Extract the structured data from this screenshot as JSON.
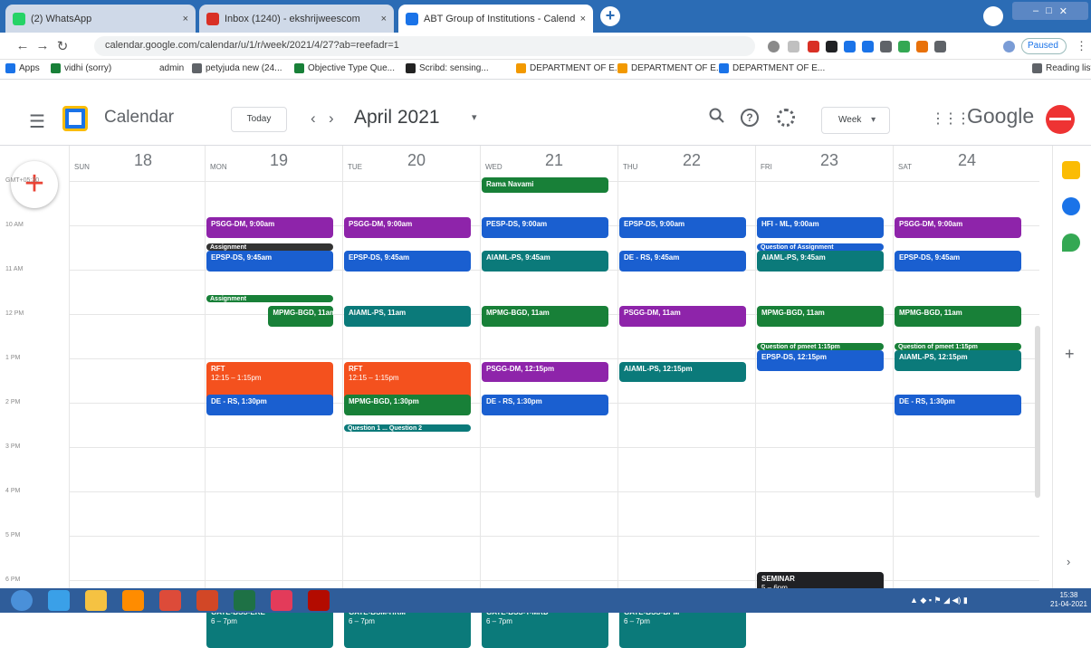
{
  "browser": {
    "tabs": [
      {
        "label": "(2) WhatsApp",
        "close": "×",
        "color": "#25d366"
      },
      {
        "label": "Inbox (1240) - ekshrijweescom",
        "close": "×",
        "color": "#d93025"
      },
      {
        "label": "ABT Group of Institutions - Calendar",
        "close": "×",
        "color": "#1a73e8"
      }
    ],
    "new_tab": "+",
    "window_controls": [
      "–",
      "□",
      "✕"
    ],
    "url": "calendar.google.com/calendar/u/1/r/week/2021/4/27?ab=reefadr=1",
    "profile_status": "Paused",
    "bookmarks": [
      {
        "label": "Apps",
        "color": "#1a73e8"
      },
      {
        "label": "vidhi (sorry)",
        "color": "#188038"
      },
      {
        "label": "admin",
        "color": "#888888"
      },
      {
        "label": "petyjuda new (24...",
        "color": "#5f6368"
      },
      {
        "label": "Objective Type Que...",
        "color": "#188038"
      },
      {
        "label": "Scribd: sensing...",
        "color": "#222222"
      },
      {
        "label": "DEPARTMENT OF E...",
        "color": "#f29900"
      },
      {
        "label": "DEPARTMENT OF E...",
        "color": "#f29900"
      },
      {
        "label": "DEPARTMENT OF E...",
        "color": "#1a73e8"
      },
      {
        "label": "Reading list",
        "color": "#5f6368"
      }
    ]
  },
  "header": {
    "app_title": "Calendar",
    "today_label": "Today",
    "prev": "‹",
    "next": "›",
    "period": "April 2021",
    "period_caret": "▾",
    "view": "Week",
    "view_caret": "▾",
    "brand": "Google",
    "help": "?"
  },
  "create_label": "+",
  "days": [
    {
      "name": "SUN",
      "num": "18"
    },
    {
      "name": "MON",
      "num": "19"
    },
    {
      "name": "TUE",
      "num": "20"
    },
    {
      "name": "WED",
      "num": "21"
    },
    {
      "name": "THU",
      "num": "22"
    },
    {
      "name": "FRI",
      "num": "23"
    },
    {
      "name": "SAT",
      "num": "24"
    }
  ],
  "time_labels": [
    "GMT+05:30",
    "10 AM",
    "11 AM",
    "12 PM",
    "1 PM",
    "2 PM",
    "3 PM",
    "4 PM",
    "5 PM",
    "6 PM"
  ],
  "all_day_events": [
    {
      "day": 3,
      "title": "Rama Navami",
      "color": "#188038"
    }
  ],
  "events": [
    {
      "day": 1,
      "start": "9:00",
      "end": "9:30",
      "title": "PSGG-DM, 9:00am",
      "time": "",
      "color": "#8e24aa"
    },
    {
      "day": 2,
      "start": "9:00",
      "end": "9:30",
      "title": "PSGG-DM, 9:00am",
      "time": "",
      "color": "#8e24aa"
    },
    {
      "day": 3,
      "start": "9:00",
      "end": "9:30",
      "title": "PESP-DS, 9:00am",
      "time": "",
      "color": "#1a5fd0"
    },
    {
      "day": 4,
      "start": "9:00",
      "end": "9:30",
      "title": "EPSP-DS, 9:00am",
      "time": "",
      "color": "#1a5fd0"
    },
    {
      "day": 5,
      "start": "9:00",
      "end": "9:30",
      "title": "HFI - ML, 9:00am",
      "time": "",
      "color": "#1a5fd0"
    },
    {
      "day": 6,
      "start": "9:00",
      "end": "9:30",
      "title": "PSGG-DM, 9:00am",
      "time": "",
      "color": "#8e24aa"
    },
    {
      "day": 1,
      "start": "9:35",
      "end": "9:45",
      "title": "Assignment",
      "time": "",
      "color": "#333333",
      "small": true
    },
    {
      "day": 1,
      "start": "9:45",
      "end": "10:15",
      "title": "EPSP-DS, 9:45am",
      "time": "",
      "color": "#1a5fd0"
    },
    {
      "day": 2,
      "start": "9:45",
      "end": "10:15",
      "title": "EPSP-DS, 9:45am",
      "time": "",
      "color": "#1a5fd0"
    },
    {
      "day": 3,
      "start": "9:45",
      "end": "10:15",
      "title": "AIAML-PS, 9:45am",
      "time": "",
      "color": "#0b7a7a"
    },
    {
      "day": 4,
      "start": "9:45",
      "end": "10:15",
      "title": "DE - RS, 9:45am",
      "time": "",
      "color": "#1a5fd0"
    },
    {
      "day": 5,
      "start": "9:35",
      "end": "9:43",
      "title": "Question of Assignment",
      "time": "",
      "color": "#1a5fd0",
      "small": true
    },
    {
      "day": 5,
      "start": "9:45",
      "end": "10:15",
      "title": "AIAML-PS, 9:45am",
      "time": "",
      "color": "#0b7a7a"
    },
    {
      "day": 6,
      "start": "9:45",
      "end": "10:15",
      "title": "EPSP-DS, 9:45am",
      "time": "",
      "color": "#1a5fd0"
    },
    {
      "day": 1,
      "start": "10:45",
      "end": "10:55",
      "title": "Assignment",
      "time": "",
      "color": "#188038",
      "small": true
    },
    {
      "day": 1,
      "start": "11:00",
      "end": "11:30",
      "title": "MPMG-BGD, 11am",
      "time": "",
      "color": "#188038",
      "shift": 0.45
    },
    {
      "day": 2,
      "start": "11:00",
      "end": "11:30",
      "title": "AIAML-PS, 11am",
      "time": "",
      "color": "#0b7a7a"
    },
    {
      "day": 3,
      "start": "11:00",
      "end": "11:30",
      "title": "MPMG-BGD, 11am",
      "time": "",
      "color": "#188038"
    },
    {
      "day": 4,
      "start": "11:00",
      "end": "11:30",
      "title": "PSGG-DM, 11am",
      "time": "",
      "color": "#8e24aa"
    },
    {
      "day": 5,
      "start": "11:00",
      "end": "11:30",
      "title": "MPMG-BGD, 11am",
      "time": "",
      "color": "#188038"
    },
    {
      "day": 6,
      "start": "11:00",
      "end": "11:30",
      "title": "MPMG-BGD, 11am",
      "time": "",
      "color": "#188038"
    },
    {
      "day": 5,
      "start": "11:50",
      "end": "11:58",
      "title": "Question of pmeet 1:15pm",
      "time": "",
      "color": "#188038",
      "small": true
    },
    {
      "day": 6,
      "start": "11:50",
      "end": "11:58",
      "title": "Question of pmeet 1:15pm",
      "time": "",
      "color": "#188038",
      "small": true
    },
    {
      "day": 1,
      "start": "12:15",
      "end": "13:15",
      "title": "RFT",
      "time": "12:15 – 1:15pm",
      "color": "#f4511e"
    },
    {
      "day": 2,
      "start": "12:15",
      "end": "13:15",
      "title": "RFT",
      "time": "12:15 – 1:15pm",
      "color": "#f4511e"
    },
    {
      "day": 3,
      "start": "12:15",
      "end": "12:45",
      "title": "PSGG-DM, 12:15pm",
      "time": "",
      "color": "#8e24aa"
    },
    {
      "day": 4,
      "start": "12:15",
      "end": "12:45",
      "title": "AIAML-PS, 12:15pm",
      "time": "",
      "color": "#0b7a7a"
    },
    {
      "day": 5,
      "start": "12:00",
      "end": "12:30",
      "title": "EPSP-DS, 12:15pm",
      "time": "",
      "color": "#1a5fd0"
    },
    {
      "day": 6,
      "start": "12:00",
      "end": "12:30",
      "title": "AIAML-PS, 12:15pm",
      "time": "",
      "color": "#0b7a7a"
    },
    {
      "day": 1,
      "start": "13:00",
      "end": "13:30",
      "title": "DE - RS, 1:30pm",
      "time": "",
      "color": "#1a5fd0"
    },
    {
      "day": 2,
      "start": "13:00",
      "end": "13:30",
      "title": "MPMG-BGD, 1:30pm",
      "time": "",
      "color": "#188038"
    },
    {
      "day": 3,
      "start": "13:00",
      "end": "13:30",
      "title": "DE - RS, 1:30pm",
      "time": "",
      "color": "#1a5fd0"
    },
    {
      "day": 6,
      "start": "13:00",
      "end": "13:30",
      "title": "DE - RS, 1:30pm",
      "time": "",
      "color": "#1a5fd0"
    },
    {
      "day": 2,
      "start": "13:40",
      "end": "13:48",
      "title": "Question 1 ... Question 2",
      "time": "",
      "color": "#0b7a7a",
      "small": true
    },
    {
      "day": 5,
      "start": "17:00",
      "end": "17:45",
      "title": "SEMINAR",
      "time": "5 – 6pm",
      "color": "#202124"
    },
    {
      "day": 1,
      "start": "17:45",
      "end": "18:45",
      "title": "GATE-BSS-ERE",
      "time": "6 – 7pm",
      "color": "#0b7a7a"
    },
    {
      "day": 2,
      "start": "17:45",
      "end": "18:45",
      "title": "GATE-BSM-HRM",
      "time": "6 – 7pm",
      "color": "#0b7a7a"
    },
    {
      "day": 3,
      "start": "17:45",
      "end": "18:45",
      "title": "GATE-BSS-T-MRD",
      "time": "6 – 7pm",
      "color": "#0b7a7a"
    },
    {
      "day": 4,
      "start": "17:45",
      "end": "18:45",
      "title": "GATE-BSS-BPM",
      "time": "6 – 7pm",
      "color": "#0b7a7a"
    }
  ],
  "side_panel": [
    {
      "name": "keep-icon",
      "color": "#fbbc04"
    },
    {
      "name": "tasks-icon",
      "color": "#1a73e8"
    },
    {
      "name": "maps-icon",
      "color": "#34a853"
    }
  ],
  "side_add": "+",
  "side_chevron": "›",
  "taskbar": {
    "apps": [
      {
        "name": "start-button",
        "color": "#4a90d9"
      },
      {
        "name": "ie-icon",
        "color": "#3aa0e8"
      },
      {
        "name": "explorer-icon",
        "color": "#f5c242"
      },
      {
        "name": "media-icon",
        "color": "#ff8c00"
      },
      {
        "name": "chrome-icon",
        "color": "#dd4b39"
      },
      {
        "name": "powerpoint-icon",
        "color": "#d24726"
      },
      {
        "name": "excel-icon",
        "color": "#1e7145"
      },
      {
        "name": "paint-icon",
        "color": "#e33b5a"
      },
      {
        "name": "pdf-icon",
        "color": "#b30b00"
      }
    ],
    "tray": "▲ ◆ ▪ ⚑ ◢ ◀) ▮",
    "clock_time": "15:38",
    "clock_date": "21-04-2021"
  }
}
